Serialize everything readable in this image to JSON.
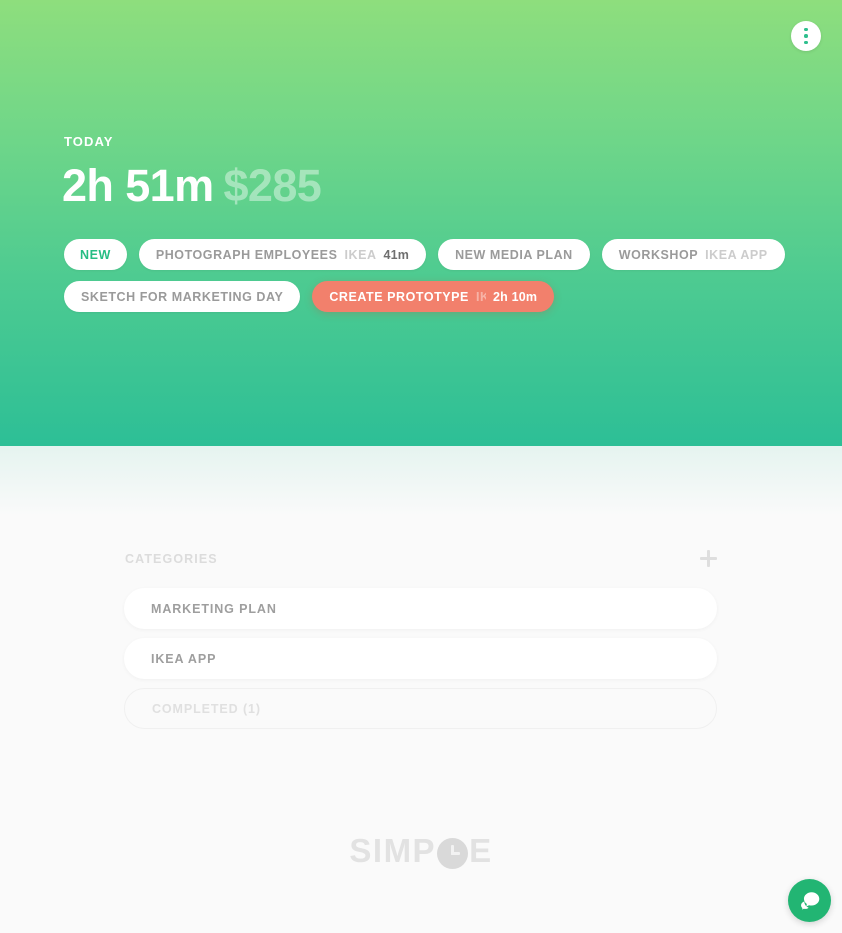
{
  "hero": {
    "menu_icon": "kebab-menu-icon",
    "today_label": "TODAY",
    "total_time": "2h 51m",
    "total_money": "$285",
    "gradient_top": "#8EDE7D",
    "gradient_bottom": "#2DBF96"
  },
  "tasks": [
    {
      "label": "NEW",
      "category": "",
      "duration": "",
      "state": "new"
    },
    {
      "label": "PHOTOGRAPH EMPLOYEES",
      "category": "IKEA APP",
      "duration": "41m",
      "state": "idle"
    },
    {
      "label": "NEW MEDIA PLAN",
      "category": "",
      "duration": "",
      "state": "idle"
    },
    {
      "label": "WORKSHOP",
      "category": "IKEA APP",
      "duration": "",
      "state": "idle"
    },
    {
      "label": "SKETCH FOR MARKETING DAY",
      "category": "",
      "duration": "",
      "state": "idle"
    },
    {
      "label": "CREATE PROTOTYPE",
      "category": "IKEA APP",
      "duration": "2h 10m",
      "state": "active"
    }
  ],
  "categories": {
    "title": "CATEGORIES",
    "add_icon": "plus-icon",
    "items": [
      {
        "label": "MARKETING PLAN",
        "done": false
      },
      {
        "label": "IKEA APP",
        "done": false
      },
      {
        "label": "COMPLETED (1)",
        "done": true
      }
    ]
  },
  "logo": {
    "part1": "SIMP",
    "clock_icon": "clock-icon",
    "part2": "E"
  },
  "chat": {
    "icon": "chat-bubble-icon",
    "color": "#22B573"
  },
  "colors": {
    "accent_green": "#2EBF8D",
    "active_red": "#F2806C"
  }
}
